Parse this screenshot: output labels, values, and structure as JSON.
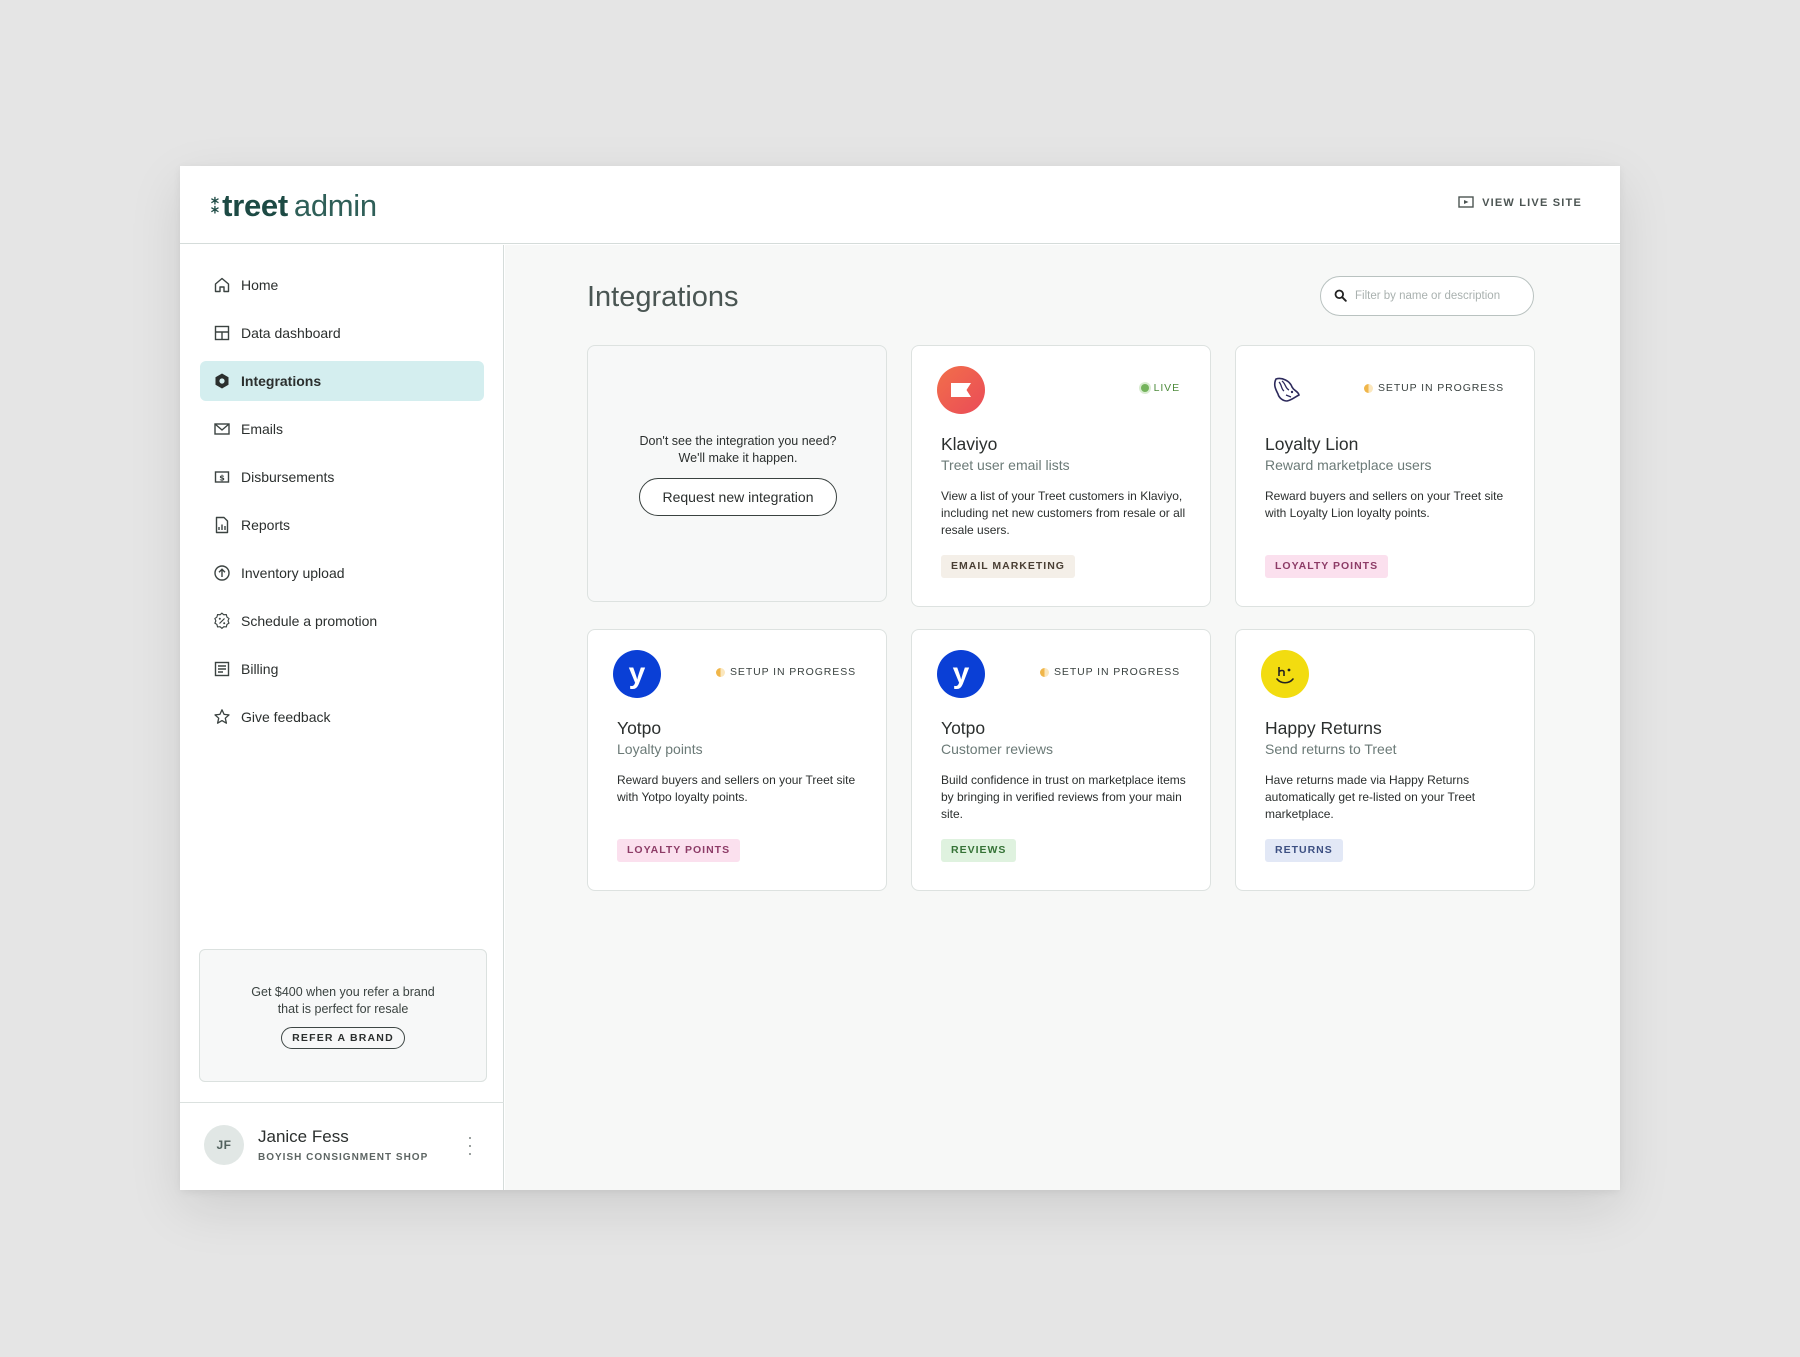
{
  "header": {
    "brand": "treet",
    "brand_suffix": "admin",
    "view_live_site": "VIEW LIVE SITE"
  },
  "sidebar": {
    "items": [
      {
        "label": "Home",
        "icon": "home-icon"
      },
      {
        "label": "Data dashboard",
        "icon": "dashboard-icon"
      },
      {
        "label": "Integrations",
        "icon": "hexagon-icon",
        "active": true
      },
      {
        "label": "Emails",
        "icon": "mail-icon"
      },
      {
        "label": "Disbursements",
        "icon": "dollar-icon"
      },
      {
        "label": "Reports",
        "icon": "report-icon"
      },
      {
        "label": "Inventory upload",
        "icon": "upload-icon"
      },
      {
        "label": "Schedule a promotion",
        "icon": "percent-badge-icon"
      },
      {
        "label": "Billing",
        "icon": "billing-icon"
      },
      {
        "label": "Give feedback",
        "icon": "star-icon"
      }
    ],
    "referral": {
      "text": "Get $400 when you refer a brand that is perfect for resale",
      "button": "REFER A BRAND"
    },
    "user": {
      "initials": "JF",
      "name": "Janice Fess",
      "shop": "BOYISH CONSIGNMENT SHOP"
    }
  },
  "main": {
    "title": "Integrations",
    "search": {
      "placeholder": "Filter by name or description",
      "value": ""
    },
    "request_card": {
      "text_line1": "Don't see the integration you need?",
      "text_line2": "We'll make it happen.",
      "button": "Request new integration"
    },
    "cards": [
      {
        "name": "Klaviyo",
        "subtitle": "Treet user email lists",
        "status": "LIVE",
        "description": "View a list of your Treet customers in Klaviyo, including net new customers from resale or all resale users.",
        "tag": "EMAIL MARKETING",
        "logo_color": "#ef5a4c"
      },
      {
        "name": "Loyalty Lion",
        "subtitle": "Reward marketplace users",
        "status": "SETUP IN PROGRESS",
        "description": "Reward buyers and sellers on your Treet site with Loyalty Lion loyalty points.",
        "tag": "LOYALTY POINTS",
        "logo_color": "#2d2a5c"
      },
      {
        "name": "Yotpo",
        "subtitle": "Loyalty points",
        "status": "SETUP IN PROGRESS",
        "description": "Reward buyers and sellers on your Treet site with Yotpo loyalty points.",
        "tag": "LOYALTY POINTS",
        "logo_letter": "y",
        "logo_color": "#0a3fd6"
      },
      {
        "name": "Yotpo",
        "subtitle": "Customer reviews",
        "status": "SETUP IN PROGRESS",
        "description": "Build confidence in trust on marketplace items by bringing in verified reviews from your main site.",
        "tag": "REVIEWS",
        "logo_letter": "y",
        "logo_color": "#0a3fd6"
      },
      {
        "name": "Happy Returns",
        "subtitle": "Send returns to Treet",
        "status": "",
        "description": "Have returns made via Happy Returns automatically get re-listed on your Treet marketplace.",
        "tag": "RETURNS",
        "logo_color": "#f2dc10"
      }
    ]
  }
}
